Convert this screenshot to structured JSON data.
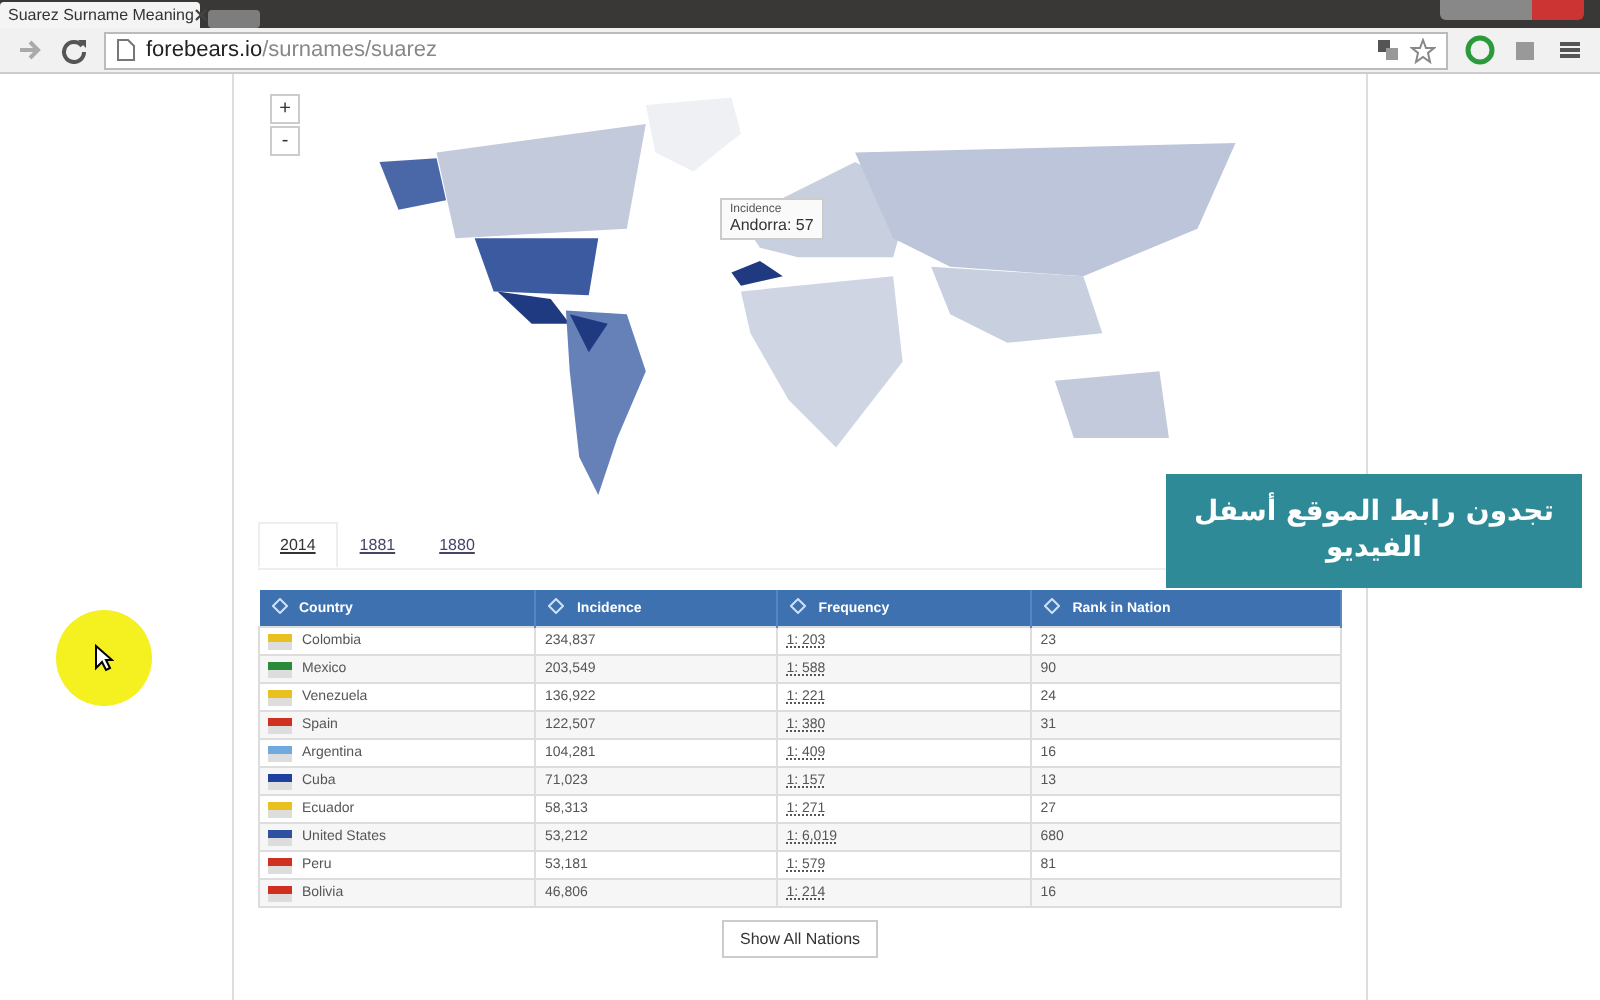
{
  "browser": {
    "tab_title": "Suarez Surname Meaning",
    "url_host": "forebears.io",
    "url_path": "/surnames/suarez"
  },
  "map": {
    "zoom_in": "+",
    "zoom_out": "-",
    "tooltip": {
      "series": "Incidence",
      "value": "Andorra: 57"
    }
  },
  "year_tabs": [
    {
      "label": "2014",
      "selected": true
    },
    {
      "label": "1881",
      "selected": false
    },
    {
      "label": "1880",
      "selected": false
    }
  ],
  "table": {
    "columns": [
      "Country",
      "Incidence",
      "Frequency",
      "Rank in Nation"
    ],
    "rows": [
      {
        "country": "Colombia",
        "incidence": "234,837",
        "frequency": "1: 203",
        "rank": "23",
        "color": "#e8c020"
      },
      {
        "country": "Mexico",
        "incidence": "203,549",
        "frequency": "1: 588",
        "rank": "90",
        "color": "#2a8a3a"
      },
      {
        "country": "Venezuela",
        "incidence": "136,922",
        "frequency": "1: 221",
        "rank": "24",
        "color": "#e8c020"
      },
      {
        "country": "Spain",
        "incidence": "122,507",
        "frequency": "1: 380",
        "rank": "31",
        "color": "#d03020"
      },
      {
        "country": "Argentina",
        "incidence": "104,281",
        "frequency": "1: 409",
        "rank": "16",
        "color": "#70a8e0"
      },
      {
        "country": "Cuba",
        "incidence": "71,023",
        "frequency": "1: 157",
        "rank": "13",
        "color": "#2040a0"
      },
      {
        "country": "Ecuador",
        "incidence": "58,313",
        "frequency": "1: 271",
        "rank": "27",
        "color": "#e8c020"
      },
      {
        "country": "United States",
        "incidence": "53,212",
        "frequency": "1: 6,019",
        "rank": "680",
        "color": "#3050a0"
      },
      {
        "country": "Peru",
        "incidence": "53,181",
        "frequency": "1: 579",
        "rank": "81",
        "color": "#d03020"
      },
      {
        "country": "Bolivia",
        "incidence": "46,806",
        "frequency": "1: 214",
        "rank": "16",
        "color": "#d03020"
      }
    ]
  },
  "show_all_button": "Show All Nations",
  "overlay_caption": "تجدون رابط الموقع أسفل الفيديو"
}
